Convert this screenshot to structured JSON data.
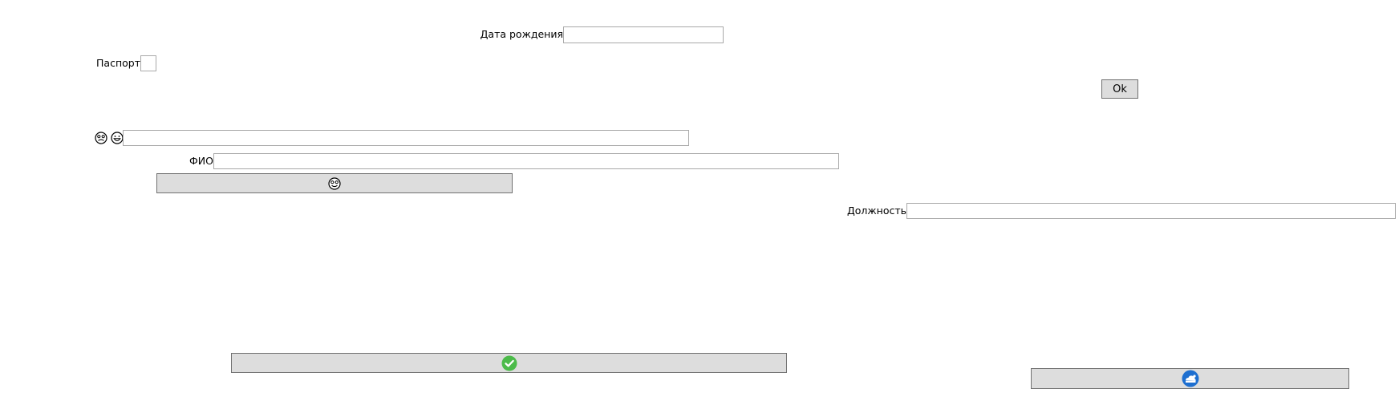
{
  "form": {
    "birth_date_label": "Дата рождения",
    "birth_date_value": "",
    "passport_label": "Паспорт",
    "passport_value": "",
    "emoji_field_value": "",
    "fio_label": "ФИО",
    "fio_value": "",
    "position_label": "Должность",
    "position_value": "",
    "ok_button_label": "Ok"
  },
  "icons": {
    "emoji_1": "sad-face-icon",
    "emoji_2": "grinning-face-icon",
    "emoji_button": "face-icon",
    "confirm_button": "green-checkmark-icon",
    "blue_button": "blue-cloud-icon"
  },
  "colors": {
    "button_bg": "#dddddd",
    "check_green": "#4cbb4a",
    "icon_blue": "#1e6fd0"
  }
}
